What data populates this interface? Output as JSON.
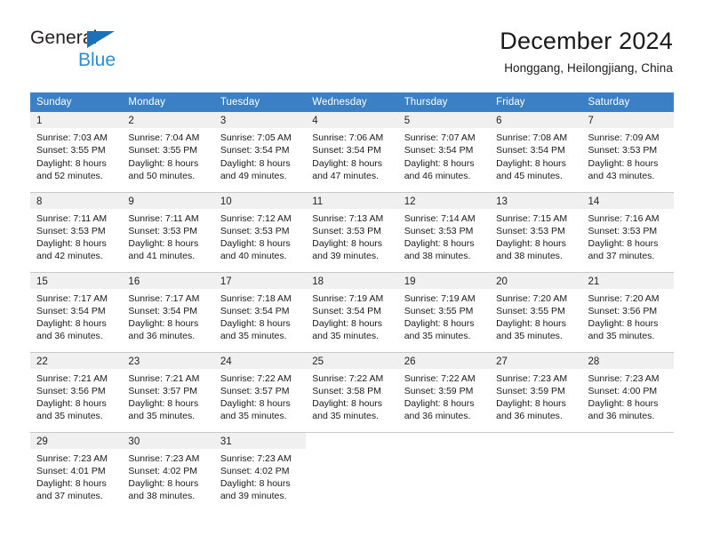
{
  "brand": {
    "line1": "General",
    "line2": "Blue",
    "triangle_color": "#1c6fba",
    "line2_color": "#2b8fd4"
  },
  "header": {
    "title": "December 2024",
    "subtitle": "Honggang, Heilongjiang, China"
  },
  "theme": {
    "header_blue": "#3b7fc4",
    "daynum_band": "#f0f0f0",
    "row_divider": "#c8c8c8",
    "text": "#1a1a1a"
  },
  "calendar": {
    "weekday_headers": [
      "Sunday",
      "Monday",
      "Tuesday",
      "Wednesday",
      "Thursday",
      "Friday",
      "Saturday"
    ],
    "weeks": [
      [
        {
          "day": "1",
          "sunrise": "Sunrise: 7:03 AM",
          "sunset": "Sunset: 3:55 PM",
          "daylight1": "Daylight: 8 hours",
          "daylight2": "and 52 minutes."
        },
        {
          "day": "2",
          "sunrise": "Sunrise: 7:04 AM",
          "sunset": "Sunset: 3:55 PM",
          "daylight1": "Daylight: 8 hours",
          "daylight2": "and 50 minutes."
        },
        {
          "day": "3",
          "sunrise": "Sunrise: 7:05 AM",
          "sunset": "Sunset: 3:54 PM",
          "daylight1": "Daylight: 8 hours",
          "daylight2": "and 49 minutes."
        },
        {
          "day": "4",
          "sunrise": "Sunrise: 7:06 AM",
          "sunset": "Sunset: 3:54 PM",
          "daylight1": "Daylight: 8 hours",
          "daylight2": "and 47 minutes."
        },
        {
          "day": "5",
          "sunrise": "Sunrise: 7:07 AM",
          "sunset": "Sunset: 3:54 PM",
          "daylight1": "Daylight: 8 hours",
          "daylight2": "and 46 minutes."
        },
        {
          "day": "6",
          "sunrise": "Sunrise: 7:08 AM",
          "sunset": "Sunset: 3:54 PM",
          "daylight1": "Daylight: 8 hours",
          "daylight2": "and 45 minutes."
        },
        {
          "day": "7",
          "sunrise": "Sunrise: 7:09 AM",
          "sunset": "Sunset: 3:53 PM",
          "daylight1": "Daylight: 8 hours",
          "daylight2": "and 43 minutes."
        }
      ],
      [
        {
          "day": "8",
          "sunrise": "Sunrise: 7:11 AM",
          "sunset": "Sunset: 3:53 PM",
          "daylight1": "Daylight: 8 hours",
          "daylight2": "and 42 minutes."
        },
        {
          "day": "9",
          "sunrise": "Sunrise: 7:11 AM",
          "sunset": "Sunset: 3:53 PM",
          "daylight1": "Daylight: 8 hours",
          "daylight2": "and 41 minutes."
        },
        {
          "day": "10",
          "sunrise": "Sunrise: 7:12 AM",
          "sunset": "Sunset: 3:53 PM",
          "daylight1": "Daylight: 8 hours",
          "daylight2": "and 40 minutes."
        },
        {
          "day": "11",
          "sunrise": "Sunrise: 7:13 AM",
          "sunset": "Sunset: 3:53 PM",
          "daylight1": "Daylight: 8 hours",
          "daylight2": "and 39 minutes."
        },
        {
          "day": "12",
          "sunrise": "Sunrise: 7:14 AM",
          "sunset": "Sunset: 3:53 PM",
          "daylight1": "Daylight: 8 hours",
          "daylight2": "and 38 minutes."
        },
        {
          "day": "13",
          "sunrise": "Sunrise: 7:15 AM",
          "sunset": "Sunset: 3:53 PM",
          "daylight1": "Daylight: 8 hours",
          "daylight2": "and 38 minutes."
        },
        {
          "day": "14",
          "sunrise": "Sunrise: 7:16 AM",
          "sunset": "Sunset: 3:53 PM",
          "daylight1": "Daylight: 8 hours",
          "daylight2": "and 37 minutes."
        }
      ],
      [
        {
          "day": "15",
          "sunrise": "Sunrise: 7:17 AM",
          "sunset": "Sunset: 3:54 PM",
          "daylight1": "Daylight: 8 hours",
          "daylight2": "and 36 minutes."
        },
        {
          "day": "16",
          "sunrise": "Sunrise: 7:17 AM",
          "sunset": "Sunset: 3:54 PM",
          "daylight1": "Daylight: 8 hours",
          "daylight2": "and 36 minutes."
        },
        {
          "day": "17",
          "sunrise": "Sunrise: 7:18 AM",
          "sunset": "Sunset: 3:54 PM",
          "daylight1": "Daylight: 8 hours",
          "daylight2": "and 35 minutes."
        },
        {
          "day": "18",
          "sunrise": "Sunrise: 7:19 AM",
          "sunset": "Sunset: 3:54 PM",
          "daylight1": "Daylight: 8 hours",
          "daylight2": "and 35 minutes."
        },
        {
          "day": "19",
          "sunrise": "Sunrise: 7:19 AM",
          "sunset": "Sunset: 3:55 PM",
          "daylight1": "Daylight: 8 hours",
          "daylight2": "and 35 minutes."
        },
        {
          "day": "20",
          "sunrise": "Sunrise: 7:20 AM",
          "sunset": "Sunset: 3:55 PM",
          "daylight1": "Daylight: 8 hours",
          "daylight2": "and 35 minutes."
        },
        {
          "day": "21",
          "sunrise": "Sunrise: 7:20 AM",
          "sunset": "Sunset: 3:56 PM",
          "daylight1": "Daylight: 8 hours",
          "daylight2": "and 35 minutes."
        }
      ],
      [
        {
          "day": "22",
          "sunrise": "Sunrise: 7:21 AM",
          "sunset": "Sunset: 3:56 PM",
          "daylight1": "Daylight: 8 hours",
          "daylight2": "and 35 minutes."
        },
        {
          "day": "23",
          "sunrise": "Sunrise: 7:21 AM",
          "sunset": "Sunset: 3:57 PM",
          "daylight1": "Daylight: 8 hours",
          "daylight2": "and 35 minutes."
        },
        {
          "day": "24",
          "sunrise": "Sunrise: 7:22 AM",
          "sunset": "Sunset: 3:57 PM",
          "daylight1": "Daylight: 8 hours",
          "daylight2": "and 35 minutes."
        },
        {
          "day": "25",
          "sunrise": "Sunrise: 7:22 AM",
          "sunset": "Sunset: 3:58 PM",
          "daylight1": "Daylight: 8 hours",
          "daylight2": "and 35 minutes."
        },
        {
          "day": "26",
          "sunrise": "Sunrise: 7:22 AM",
          "sunset": "Sunset: 3:59 PM",
          "daylight1": "Daylight: 8 hours",
          "daylight2": "and 36 minutes."
        },
        {
          "day": "27",
          "sunrise": "Sunrise: 7:23 AM",
          "sunset": "Sunset: 3:59 PM",
          "daylight1": "Daylight: 8 hours",
          "daylight2": "and 36 minutes."
        },
        {
          "day": "28",
          "sunrise": "Sunrise: 7:23 AM",
          "sunset": "Sunset: 4:00 PM",
          "daylight1": "Daylight: 8 hours",
          "daylight2": "and 36 minutes."
        }
      ],
      [
        {
          "day": "29",
          "sunrise": "Sunrise: 7:23 AM",
          "sunset": "Sunset: 4:01 PM",
          "daylight1": "Daylight: 8 hours",
          "daylight2": "and 37 minutes."
        },
        {
          "day": "30",
          "sunrise": "Sunrise: 7:23 AM",
          "sunset": "Sunset: 4:02 PM",
          "daylight1": "Daylight: 8 hours",
          "daylight2": "and 38 minutes."
        },
        {
          "day": "31",
          "sunrise": "Sunrise: 7:23 AM",
          "sunset": "Sunset: 4:02 PM",
          "daylight1": "Daylight: 8 hours",
          "daylight2": "and 39 minutes."
        },
        null,
        null,
        null,
        null
      ]
    ]
  }
}
